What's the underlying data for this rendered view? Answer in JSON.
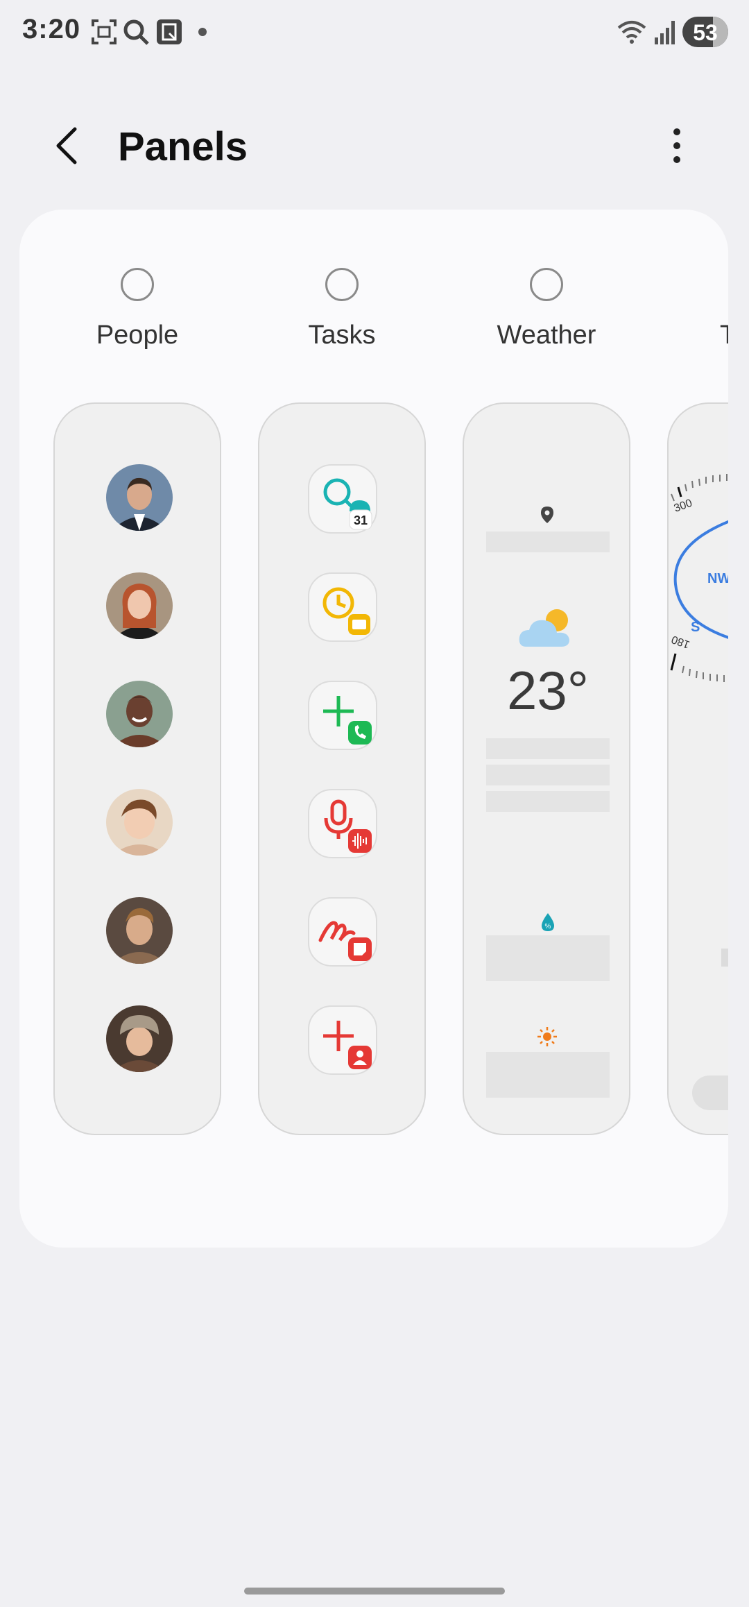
{
  "status_bar": {
    "time": "3:20",
    "battery": "53"
  },
  "header": {
    "title": "Panels",
    "back_icon": "back-arrow-icon",
    "more_icon": "more-vertical-icon"
  },
  "panels": [
    {
      "label": "People"
    },
    {
      "label": "Tasks"
    },
    {
      "label": "Weather"
    },
    {
      "label": "T"
    }
  ],
  "weather": {
    "temperature": "23°"
  },
  "compass": {
    "direction_label": "NW",
    "south_label": "S",
    "tick_300": "300",
    "tick_180": "180"
  },
  "task_badges": {
    "calendar_day": "31"
  },
  "colors": {
    "accent_blue": "#3b7de0",
    "teal": "#19b3b3",
    "yellow": "#f2b705",
    "green": "#1db954",
    "red": "#e53935"
  }
}
